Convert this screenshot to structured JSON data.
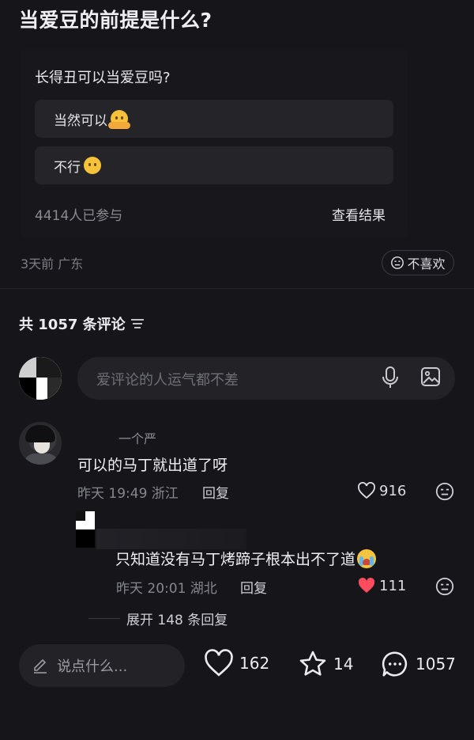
{
  "post": {
    "title": "当爱豆的前提是什么?"
  },
  "poll": {
    "question": "长得丑可以当爱豆吗?",
    "options": [
      {
        "label": "当然可以",
        "emoji": "hugging-face-emoji"
      },
      {
        "label": "不行",
        "emoji": "no-mouth-face-emoji"
      }
    ],
    "participants": "4414人已参与",
    "view_results": "查看结果"
  },
  "meta": {
    "time_location": "3天前 广东",
    "dislike_label": "不喜欢"
  },
  "comments_header": {
    "total_label": "共 1057 条评论"
  },
  "comment_input": {
    "placeholder": "爱评论的人运气都不差"
  },
  "comments": [
    {
      "username": "一个严",
      "text": "可以的马丁就出道了呀",
      "time_location": "昨天 19:49 浙江",
      "reply_label": "回复",
      "likes": "916",
      "liked": false
    }
  ],
  "replies": [
    {
      "text": "只知道没有马丁烤蹄子根本出不了道",
      "time_location": "昨天 20:01 湖北",
      "reply_label": "回复",
      "likes": "111",
      "liked": true
    }
  ],
  "expand_label": "展开 148 条回复",
  "bottom_bar": {
    "input_placeholder": "说点什么...",
    "likes": "162",
    "favorites": "14",
    "comments": "1057"
  },
  "colors": {
    "background": "#15151a",
    "liked_heart": "#ff4d5e"
  }
}
